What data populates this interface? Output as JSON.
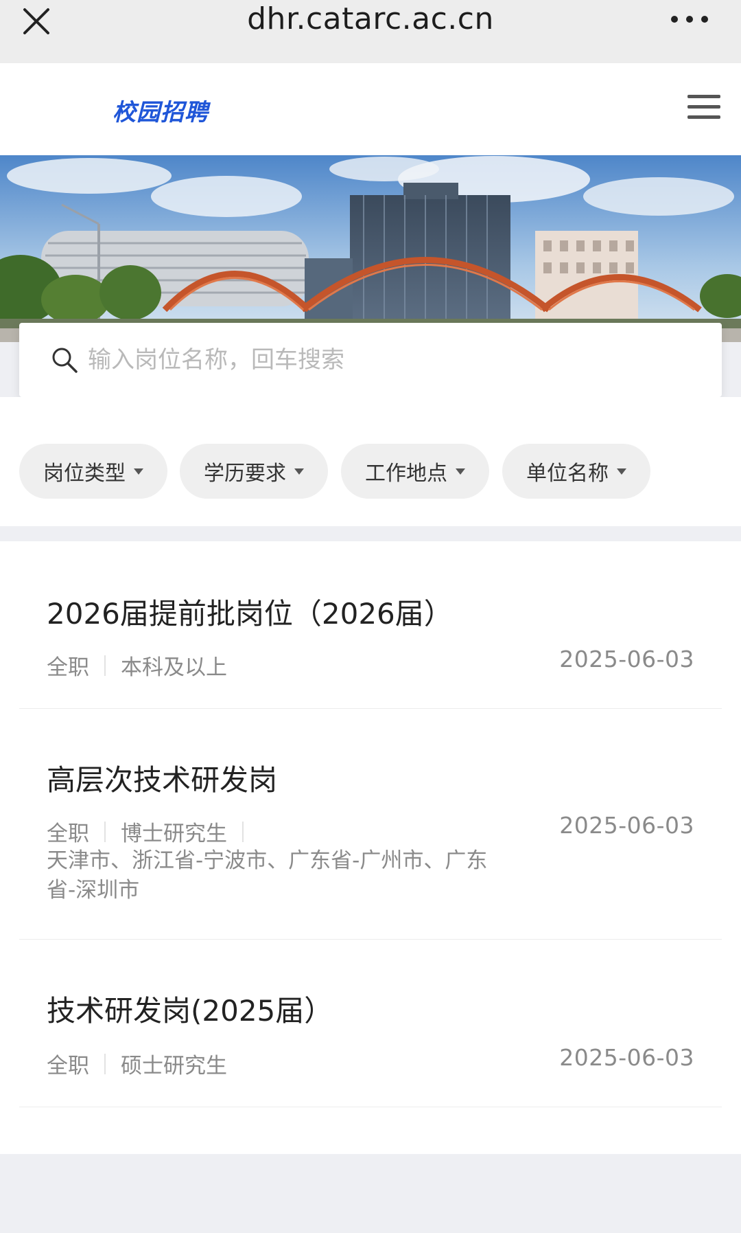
{
  "browser": {
    "url": "dhr.catarc.ac.cn"
  },
  "header": {
    "logo_text": "校园招聘"
  },
  "search": {
    "placeholder": "输入岗位名称，回车搜索"
  },
  "filters": [
    {
      "label": "岗位类型"
    },
    {
      "label": "学历要求"
    },
    {
      "label": "工作地点"
    },
    {
      "label": "单位名称"
    }
  ],
  "jobs": [
    {
      "title": "2026届提前批岗位（2026届）",
      "type": "全职",
      "education": "本科及以上",
      "location": "",
      "date": "2025-06-03"
    },
    {
      "title": "高层次技术研发岗",
      "type": "全职",
      "education": "博士研究生",
      "location": "天津市、浙江省-宁波市、广东省-广州市、广东省-深圳市",
      "date": "2025-06-03"
    },
    {
      "title": "技术研发岗(2025届）",
      "type": "全职",
      "education": "硕士研究生",
      "location": "",
      "date": "2025-06-03"
    }
  ],
  "colors": {
    "brand": "#1f56d8",
    "page_bg": "#eeeff3",
    "chip_bg": "#efefef",
    "muted_text": "#8a8a8a"
  }
}
